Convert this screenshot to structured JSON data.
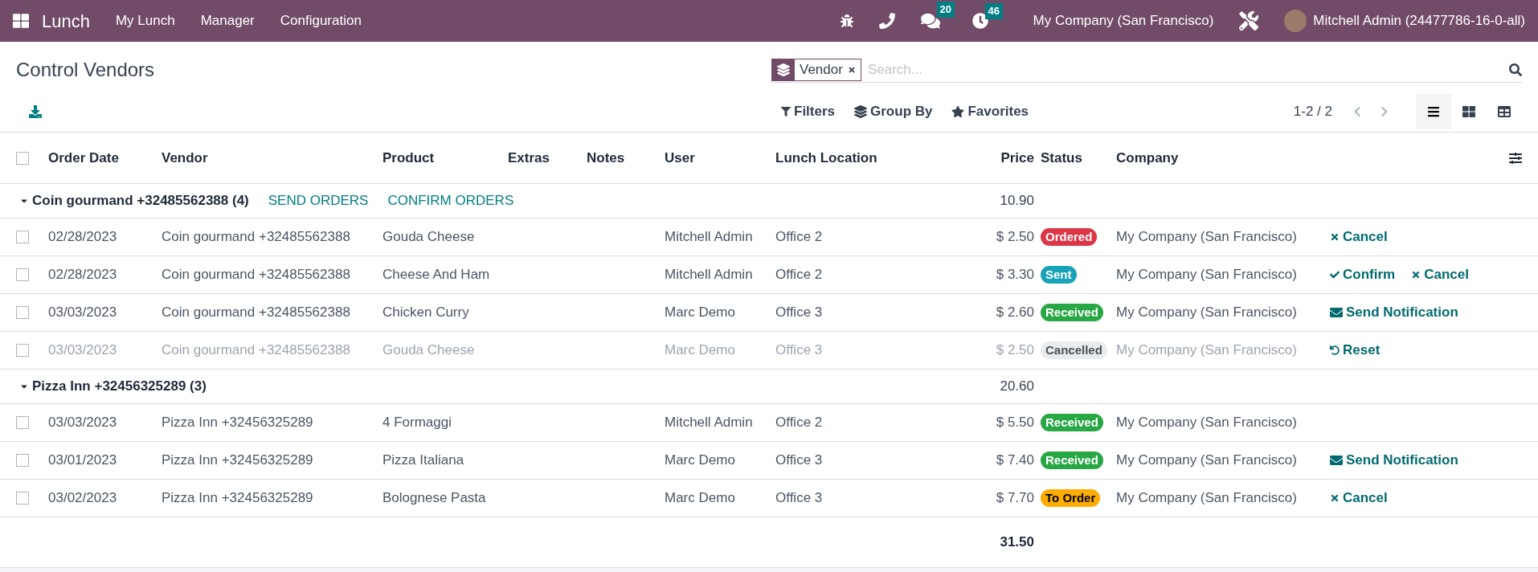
{
  "navbar": {
    "app_name": "Lunch",
    "menu": [
      "My Lunch",
      "Manager",
      "Configuration"
    ],
    "messages_count": "20",
    "activities_count": "46",
    "company": "My Company (San Francisco)",
    "user": "Mitchell Admin (24477786-16-0-all)"
  },
  "control_panel": {
    "title": "Control Vendors",
    "facet": {
      "label": "Vendor"
    },
    "search": {
      "placeholder": "Search..."
    },
    "filters": [
      "Filters",
      "Group By",
      "Favorites"
    ],
    "pager": "1-2 / 2",
    "views": [
      {
        "kind": "list",
        "selected": true
      },
      {
        "kind": "kanban",
        "selected": false
      },
      {
        "kind": "pivot",
        "selected": false
      }
    ]
  },
  "table": {
    "select_all": {
      "checked": false
    },
    "columns": [
      "Order Date",
      "Vendor",
      "Product",
      "Extras",
      "Notes",
      "User",
      "Lunch Location",
      "Price",
      "Status",
      "Company"
    ],
    "groups": [
      {
        "label": "Coin gourmand +32485562388 (4)",
        "expanded": true,
        "total": "10.90",
        "actions": [
          "SEND ORDERS",
          "CONFIRM ORDERS"
        ],
        "rows": [
          {
            "checked": false,
            "dimmed": false,
            "date": "02/28/2023",
            "vendor": "Coin gourmand +32485562388",
            "product": "Gouda Cheese",
            "user": "Mitchell Admin",
            "location": "Office 2",
            "price": "$ 2.50",
            "status": {
              "label": "Ordered",
              "kind": "ordered"
            },
            "company": "My Company (San Francisco)",
            "actions": [
              {
                "label": "Cancel",
                "kind": "cancel"
              }
            ]
          },
          {
            "checked": false,
            "dimmed": false,
            "date": "02/28/2023",
            "vendor": "Coin gourmand +32485562388",
            "product": "Cheese And Ham",
            "user": "Mitchell Admin",
            "location": "Office 2",
            "price": "$ 3.30",
            "status": {
              "label": "Sent",
              "kind": "sent"
            },
            "company": "My Company (San Francisco)",
            "actions": [
              {
                "label": "Confirm",
                "kind": "confirm"
              },
              {
                "label": "Cancel",
                "kind": "cancel"
              }
            ]
          },
          {
            "checked": false,
            "dimmed": false,
            "date": "03/03/2023",
            "vendor": "Coin gourmand +32485562388",
            "product": "Chicken Curry",
            "user": "Marc Demo",
            "location": "Office 3",
            "price": "$ 2.60",
            "status": {
              "label": "Received",
              "kind": "received"
            },
            "company": "My Company (San Francisco)",
            "actions": [
              {
                "label": "Send Notification",
                "kind": "notify"
              }
            ]
          },
          {
            "checked": false,
            "dimmed": true,
            "date": "03/03/2023",
            "vendor": "Coin gourmand +32485562388",
            "product": "Gouda Cheese",
            "user": "Marc Demo",
            "location": "Office 3",
            "price": "$ 2.50",
            "status": {
              "label": "Cancelled",
              "kind": "cancelled"
            },
            "company": "My Company (San Francisco)",
            "actions": [
              {
                "label": "Reset",
                "kind": "reset"
              }
            ]
          }
        ]
      },
      {
        "label": "Pizza Inn +32456325289 (3)",
        "expanded": true,
        "total": "20.60",
        "rows": [
          {
            "checked": false,
            "dimmed": false,
            "date": "03/03/2023",
            "vendor": "Pizza Inn +32456325289",
            "product": "4 Formaggi",
            "user": "Mitchell Admin",
            "location": "Office 2",
            "price": "$ 5.50",
            "status": {
              "label": "Received",
              "kind": "received"
            },
            "company": "My Company (San Francisco)",
            "actions": []
          },
          {
            "checked": false,
            "dimmed": false,
            "date": "03/01/2023",
            "vendor": "Pizza Inn +32456325289",
            "product": "Pizza Italiana",
            "user": "Marc Demo",
            "location": "Office 3",
            "price": "$ 7.40",
            "status": {
              "label": "Received",
              "kind": "received"
            },
            "company": "My Company (San Francisco)",
            "actions": [
              {
                "label": "Send Notification",
                "kind": "notify"
              }
            ]
          },
          {
            "checked": false,
            "dimmed": false,
            "date": "03/02/2023",
            "vendor": "Pizza Inn +32456325289",
            "product": "Bolognese Pasta",
            "user": "Marc Demo",
            "location": "Office 3",
            "price": "$ 7.70",
            "status": {
              "label": "To Order",
              "kind": "to_order"
            },
            "company": "My Company (San Francisco)",
            "actions": [
              {
                "label": "Cancel",
                "kind": "cancel"
              }
            ]
          }
        ]
      }
    ],
    "grand_total": "31.50"
  }
}
